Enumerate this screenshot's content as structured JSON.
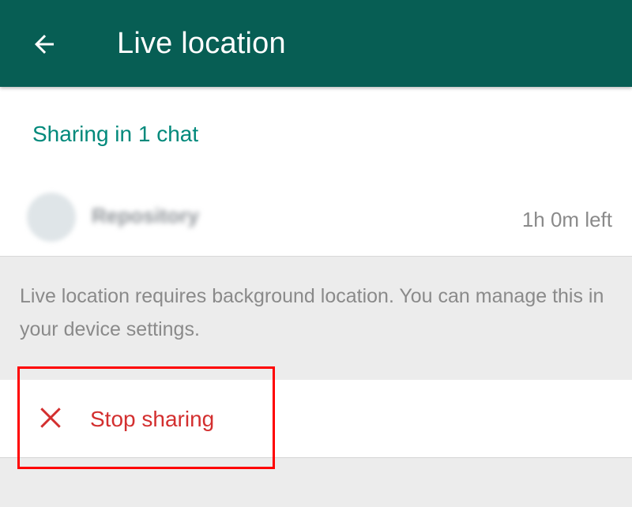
{
  "app_bar": {
    "title": "Live location",
    "back_icon": "arrow-back-icon",
    "background_color": "#075e54"
  },
  "sharing": {
    "header": "Sharing in 1 chat",
    "accent_color": "#00897b",
    "chats": [
      {
        "name": "Repository",
        "time_left": "1h 0m left"
      }
    ]
  },
  "info": {
    "text": "Live location requires background location. You can manage this in your device settings."
  },
  "stop": {
    "label": "Stop sharing",
    "icon": "close-icon",
    "color": "#d32f2f"
  },
  "annotation": {
    "highlight_color": "#ff0000"
  }
}
